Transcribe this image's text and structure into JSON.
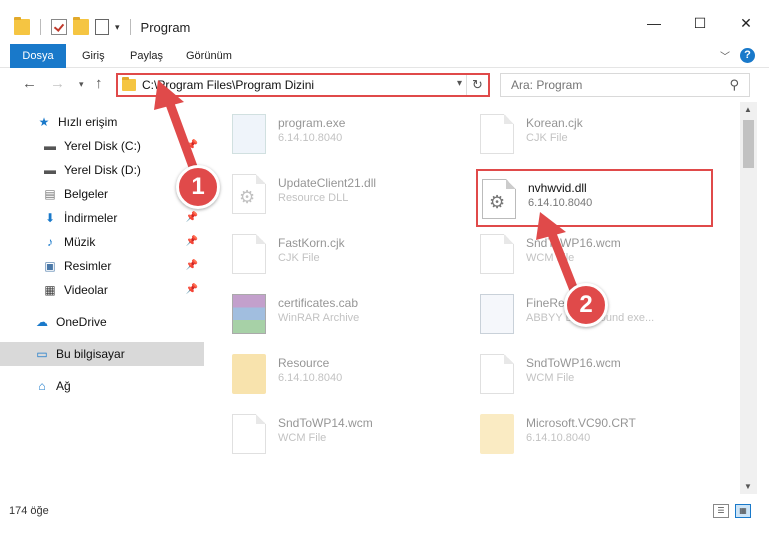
{
  "window": {
    "title": "Program",
    "minimize": "—",
    "maximize": "☐",
    "close": "✕"
  },
  "ribbon": {
    "tabs": [
      "Dosya",
      "Giriş",
      "Paylaş",
      "Görünüm"
    ],
    "help": "?"
  },
  "nav": {
    "address": "C:\\Program Files\\Program Dizini",
    "search_placeholder": "Ara: Program"
  },
  "sidebar": {
    "items": [
      {
        "label": "Hızlı erişim",
        "icon": "star-icon"
      },
      {
        "label": "Yerel Disk (C:)",
        "icon": "drive-icon"
      },
      {
        "label": "Yerel Disk (D:)",
        "icon": "drive-icon"
      },
      {
        "label": "Belgeler",
        "icon": "document-icon"
      },
      {
        "label": "İndirmeler",
        "icon": "download-icon"
      },
      {
        "label": "Müzik",
        "icon": "music-icon"
      },
      {
        "label": "Resimler",
        "icon": "image-icon"
      },
      {
        "label": "Videolar",
        "icon": "video-icon"
      },
      {
        "label": "OneDrive",
        "icon": "cloud-icon"
      },
      {
        "label": "Bu bilgisayar",
        "icon": "computer-icon"
      },
      {
        "label": "Ağ",
        "icon": "network-icon"
      }
    ]
  },
  "files": {
    "left": [
      {
        "name": "program.exe",
        "desc": "6.14.10.8040"
      },
      {
        "name": "UpdateClient21.dll",
        "desc": "Resource DLL"
      },
      {
        "name": "FastKorn.cjk",
        "desc": "CJK File"
      },
      {
        "name": "certificates.cab",
        "desc": "WinRAR Archive"
      },
      {
        "name": "Resource",
        "desc": "6.14.10.8040"
      },
      {
        "name": "SndToWP14.wcm",
        "desc": "WCM File"
      }
    ],
    "right": [
      {
        "name": "Korean.cjk",
        "desc": "CJK File"
      },
      {
        "name": "nvhwvid.dll",
        "desc": "6.14.10.8040"
      },
      {
        "name": "SndToWP16.wcm",
        "desc": "WCM File"
      },
      {
        "name": "FineReader",
        "desc": "ABBYY Background exe..."
      },
      {
        "name": "SndToWP16.wcm",
        "desc": "WCM File"
      },
      {
        "name": "Microsoft.VC90.CRT",
        "desc": "6.14.10.8040"
      }
    ]
  },
  "status": {
    "count": "174 öğe"
  },
  "annotations": {
    "step1": "1",
    "step2": "2",
    "color": "#e04a4a"
  }
}
